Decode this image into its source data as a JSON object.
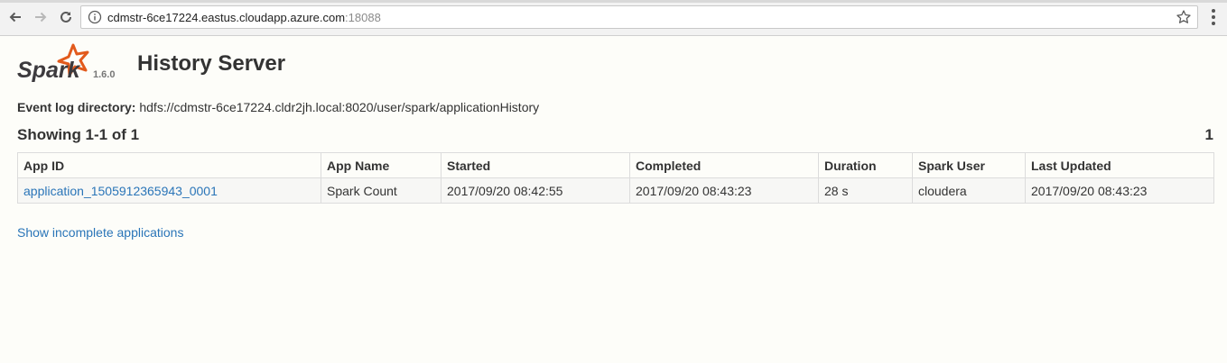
{
  "browser": {
    "url_host": "cdmstr-6ce17224.eastus.cloudapp.azure.com",
    "url_port": ":18088"
  },
  "header": {
    "logo_text": "Spark",
    "version": "1.6.0",
    "title": "History Server"
  },
  "event_log": {
    "label": "Event log directory:",
    "path": "hdfs://cdmstr-6ce17224.cldr2jh.local:8020/user/spark/applicationHistory"
  },
  "pagination": {
    "showing": "Showing 1-1 of 1",
    "page": "1"
  },
  "table": {
    "columns": [
      "App ID",
      "App Name",
      "Started",
      "Completed",
      "Duration",
      "Spark User",
      "Last Updated"
    ],
    "rows": [
      {
        "app_id": "application_1505912365943_0001",
        "app_name": "Spark Count",
        "started": "2017/09/20 08:42:55",
        "completed": "2017/09/20 08:43:23",
        "duration": "28 s",
        "spark_user": "cloudera",
        "last_updated": "2017/09/20 08:43:23"
      }
    ]
  },
  "links": {
    "show_incomplete": "Show incomplete applications"
  },
  "colors": {
    "link": "#2a75b8",
    "spark_orange": "#e25a1c",
    "background": "#fdfdf9"
  }
}
